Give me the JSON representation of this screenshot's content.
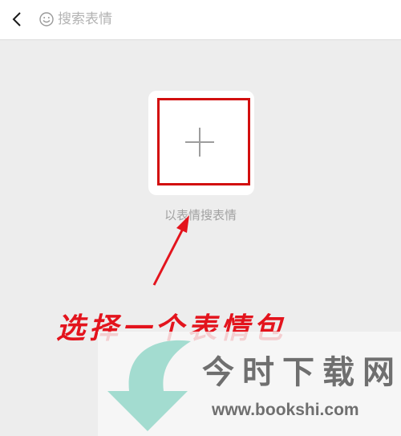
{
  "search_bar": {
    "back_icon": "chevron-left-icon",
    "search_icon": "smiley-icon",
    "placeholder": "搜索表情"
  },
  "main": {
    "add_icon": "plus-icon",
    "caption": "以表情搜表情"
  },
  "annotation": {
    "text": "选择一个表情包",
    "color": "#e3141d"
  },
  "watermark": {
    "site_name": "今时下载网",
    "url": "www.bookshi.com",
    "arrow_color": "#a3dcd0"
  }
}
